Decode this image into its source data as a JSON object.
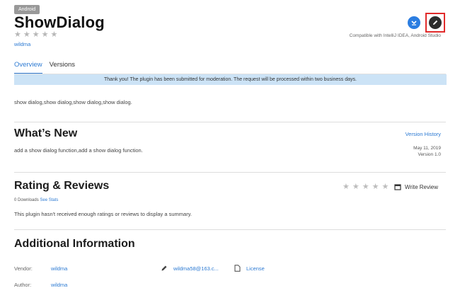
{
  "header": {
    "tag": "Android",
    "title": "ShowDialog",
    "vendor": "wildma",
    "rating_stars": 5,
    "compatibility": "Compatible with IntelliJ IDEA, Android Studio"
  },
  "icons": {
    "download": "download-icon",
    "edit": "pencil-icon",
    "write_review": "calendar-icon",
    "vendor_email": "pencil-icon",
    "license": "document-icon"
  },
  "colors": {
    "accent": "#2e7bd3",
    "banner_bg": "#cce3f6",
    "highlight_border": "#e12b2b",
    "star": "#b7b7b7"
  },
  "tabs": [
    {
      "label": "Overview",
      "active": true
    },
    {
      "label": "Versions",
      "active": false
    }
  ],
  "banner": "Thank you! The plugin has been submitted for moderation. The request will be processed within two business days.",
  "description": "show dialog,show dialog,show dialog,show dialog.",
  "whats_new": {
    "heading": "What’s New",
    "history_link": "Version History",
    "text": "add a show dialog function,add a show dialog function.",
    "date": "May 11, 2019",
    "version": "Version 1.0"
  },
  "ratings": {
    "heading": "Rating & Reviews",
    "downloads": "0 Downloads",
    "see_stats": "See Stats",
    "write_review": "Write Review",
    "summary": "This plugin hasn't received enough ratings or reviews to display a summary."
  },
  "additional": {
    "heading": "Additional Information",
    "vendor_label": "Vendor:",
    "vendor_value": "wildma",
    "email": "wildma58@163.c...",
    "license": "License",
    "author_label": "Author:",
    "author_value": "wildma"
  }
}
